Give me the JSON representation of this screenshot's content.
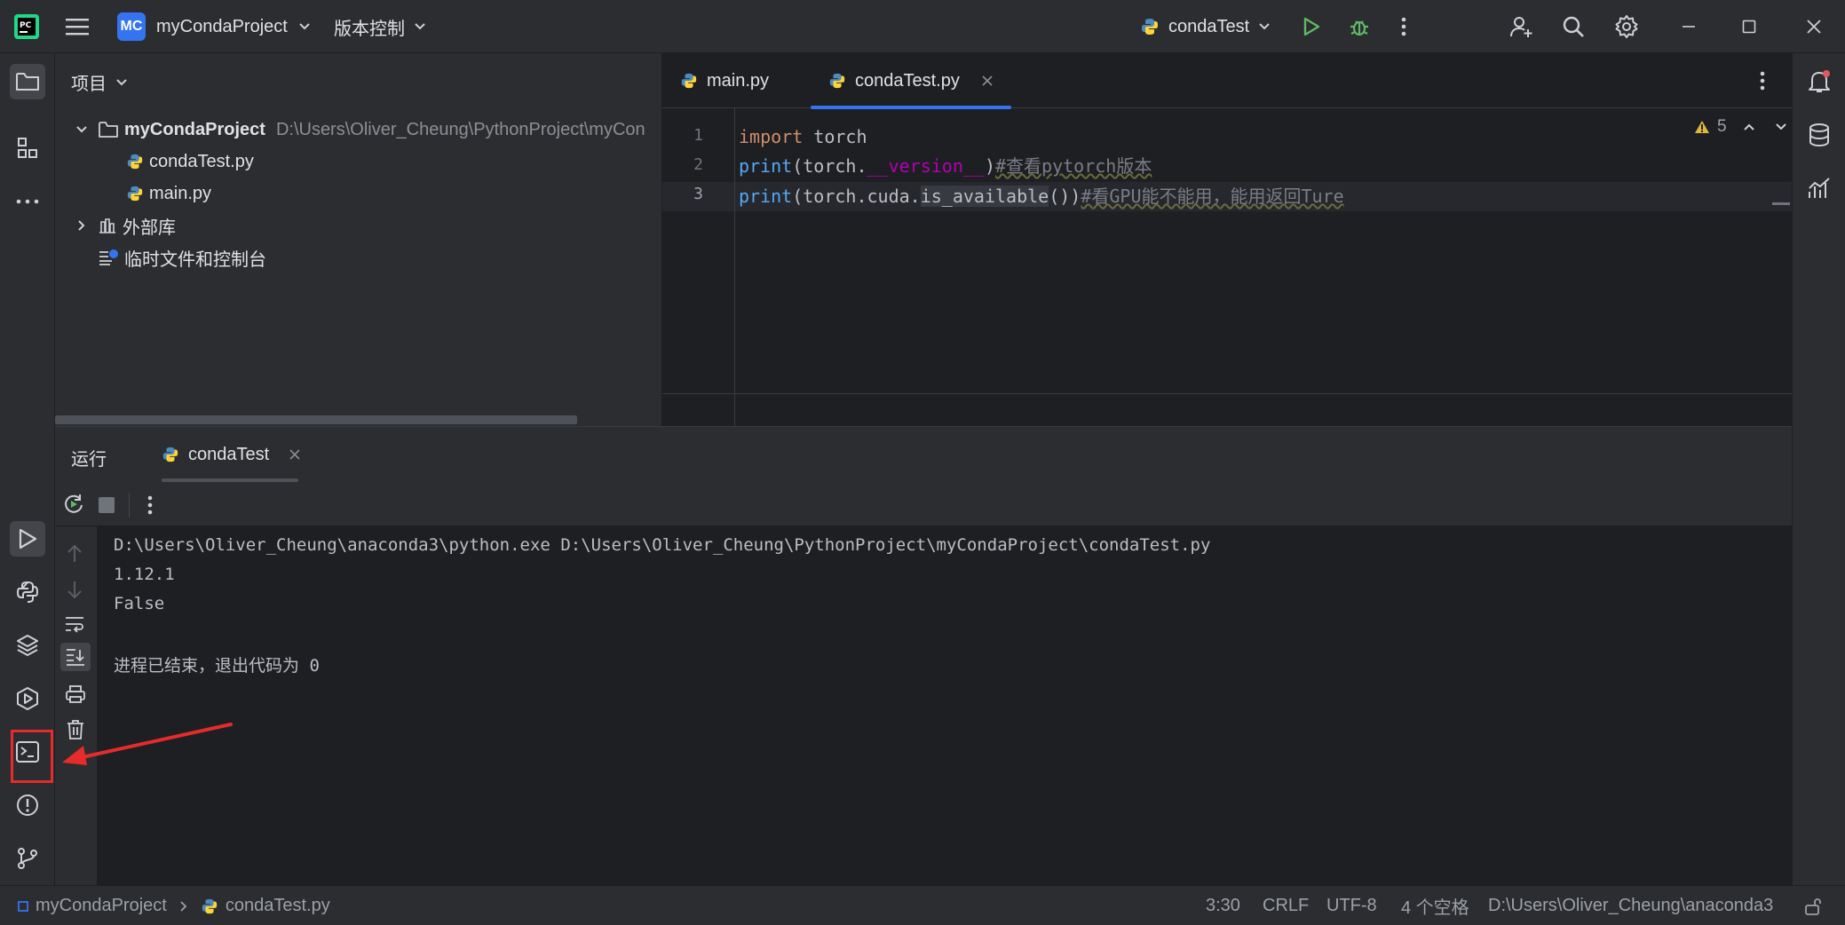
{
  "titlebar": {
    "project_badge": "MC",
    "project_name": "myCondaProject",
    "vcs_label": "版本控制",
    "run_config": "condaTest"
  },
  "project_panel": {
    "title": "项目",
    "root_name": "myCondaProject",
    "root_path": "D:\\Users\\Oliver_Cheung\\PythonProject\\myCon",
    "files": [
      "condaTest.py",
      "main.py"
    ],
    "external_libs": "外部库",
    "scratches": "临时文件和控制台"
  },
  "editor": {
    "tabs": [
      {
        "label": "main.py",
        "active": false
      },
      {
        "label": "condaTest.py",
        "active": true
      }
    ],
    "warning_count": "5",
    "line_numbers": [
      "1",
      "2",
      "3"
    ],
    "lines": {
      "l1_kw": "import",
      "l1_rest": " torch",
      "l2_fn": "print",
      "l2_a": "(torch.",
      "l2_dunder": "__version__",
      "l2_b": ")",
      "l2_comment": "#查看pytorch版本",
      "l3_fn": "print",
      "l3_a": "(torch.cuda.",
      "l3_method": "is_available",
      "l3_b": "())",
      "l3_comment": "#看GPU能不能用，能用返回Ture"
    }
  },
  "run_panel": {
    "label": "运行",
    "tab": "condaTest",
    "output": [
      "D:\\Users\\Oliver_Cheung\\anaconda3\\python.exe D:\\Users\\Oliver_Cheung\\PythonProject\\myCondaProject\\condaTest.py",
      "1.12.1",
      "False",
      "",
      "进程已结束，退出代码为 0"
    ]
  },
  "statusbar": {
    "breadcrumb_project": "myCondaProject",
    "breadcrumb_file": "condaTest.py",
    "position": "3:30",
    "line_sep": "CRLF",
    "encoding": "UTF-8",
    "indent": "4 个空格",
    "interpreter": "D:\\Users\\Oliver_Cheung\\anaconda3"
  },
  "colors": {
    "accent": "#3574f0",
    "annotation": "#e52b2b",
    "run_green": "#5fb865"
  }
}
